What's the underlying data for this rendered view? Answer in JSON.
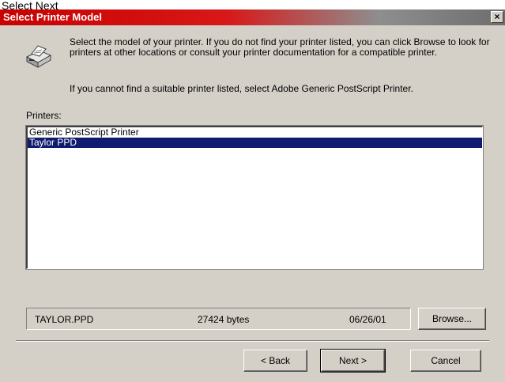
{
  "caption": "Select Next",
  "dialog": {
    "title": "Select Printer Model",
    "close_glyph": "×",
    "description": "Select the model of your printer. If you do not find your printer listed, you can click Browse to look for printers at other locations or consult your printer documentation for a compatible printer.",
    "hint": "If you cannot find a suitable printer listed, select Adobe Generic PostScript Printer.",
    "printers_label": "Printers:",
    "printers": [
      {
        "label": "Generic PostScript Printer",
        "selected": false
      },
      {
        "label": "Taylor PPD",
        "selected": true
      }
    ],
    "file_info": {
      "name": "TAYLOR.PPD",
      "size": "27424 bytes",
      "date": "06/26/01"
    },
    "buttons": {
      "browse": "Browse...",
      "back": "< Back",
      "next": "Next >",
      "cancel": "Cancel"
    }
  }
}
